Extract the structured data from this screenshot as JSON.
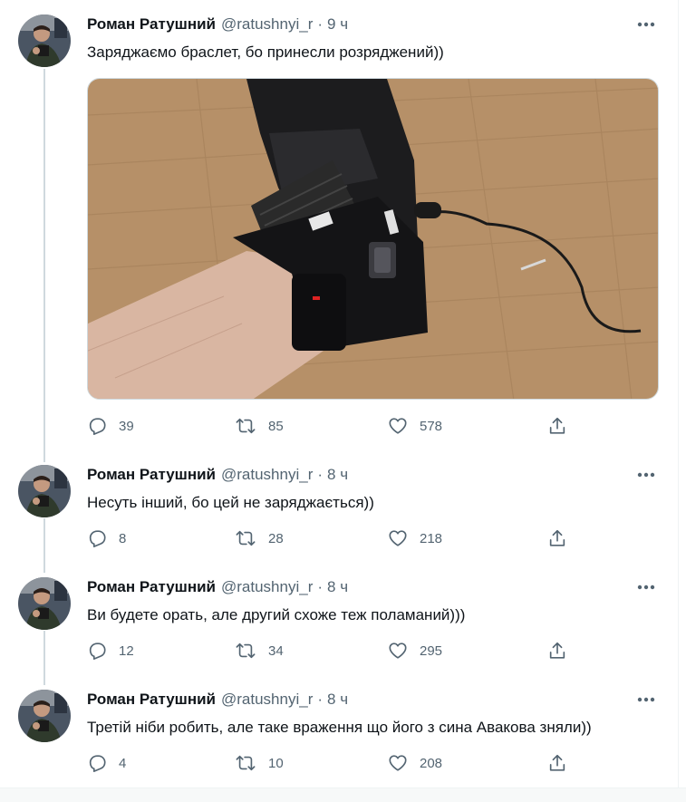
{
  "author": {
    "name": "Роман Ратушний",
    "handle": "@ratushnyi_r",
    "dot": "·"
  },
  "tweets": [
    {
      "time": "9 ч",
      "text": "Заряджаємо браслет, бо принесли розряджений))",
      "replies": "39",
      "retweets": "85",
      "likes": "578"
    },
    {
      "time": "8 ч",
      "text": "Несуть інший, бо цей не заряджається))",
      "replies": "8",
      "retweets": "28",
      "likes": "218"
    },
    {
      "time": "8 ч",
      "text": "Ви будете орать, але другий схоже теж поламаний)))",
      "replies": "12",
      "retweets": "34",
      "likes": "295"
    },
    {
      "time": "8 ч",
      "text": "Третій ніби робить, але таке враження що його з сина Авакова зняли))",
      "replies": "4",
      "retweets": "10",
      "likes": "208"
    }
  ],
  "colors": {
    "text": "#0f1419",
    "secondary": "#536471",
    "thread_line": "#cfd9de"
  },
  "icons": [
    "more-icon",
    "reply-icon",
    "retweet-icon",
    "like-icon",
    "share-icon"
  ]
}
